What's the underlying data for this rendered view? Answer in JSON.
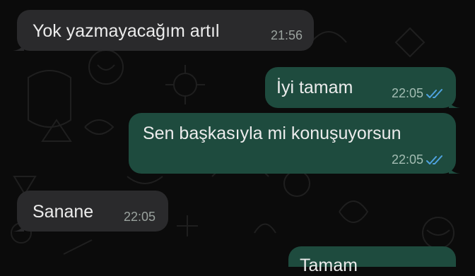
{
  "colors": {
    "background": "#0b0b0b",
    "incoming_bubble": "#2a2a2c",
    "outgoing_bubble": "#1e4b3e",
    "read_ticks": "#4fa3e0",
    "doodle_stroke": "#1f1f1f"
  },
  "messages": [
    {
      "direction": "incoming",
      "text": "Yok yazmayacağım artıl",
      "time": "21:56"
    },
    {
      "direction": "outgoing",
      "text": "İyi tamam",
      "time": "22:05",
      "status_icon": "double-check-read-icon"
    },
    {
      "direction": "outgoing",
      "text": "Sen başkasıyla mi konuşuyorsun",
      "time": "22:05",
      "status_icon": "double-check-read-icon"
    },
    {
      "direction": "incoming",
      "text": "Sanane",
      "time": "22:05"
    },
    {
      "direction": "outgoing",
      "text": "Tamam",
      "time": ""
    }
  ]
}
